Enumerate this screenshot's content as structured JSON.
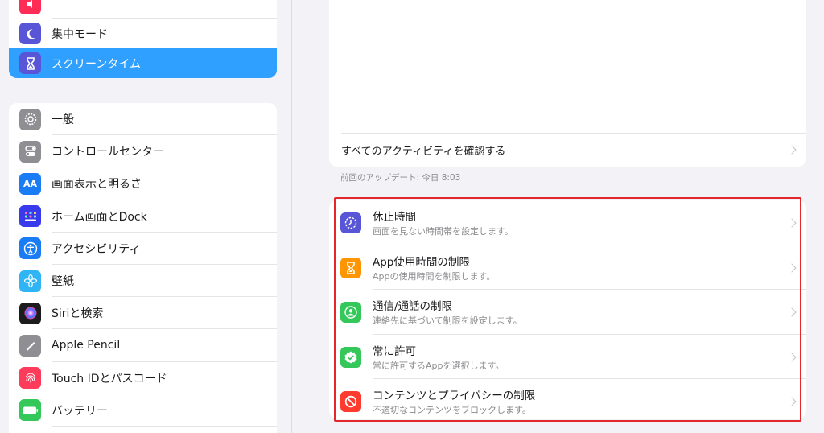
{
  "sidebar": {
    "group1": [
      {
        "label": "",
        "icon": "sound-icon",
        "color": "#ff2d55"
      },
      {
        "label": "集中モード",
        "icon": "moon-icon",
        "color": "#5856d6"
      },
      {
        "label": "スクリーンタイム",
        "icon": "hourglass-icon",
        "color": "#5856d6",
        "selected": true
      }
    ],
    "group2": [
      {
        "label": "一般",
        "icon": "gear-icon",
        "color": "#8e8e93"
      },
      {
        "label": "コントロールセンター",
        "icon": "toggles-icon",
        "color": "#8e8e93"
      },
      {
        "label": "画面表示と明るさ",
        "icon": "text-size-icon",
        "color": "#1a7cf5"
      },
      {
        "label": "ホーム画面とDock",
        "icon": "grid-icon",
        "color": "#3a3aed"
      },
      {
        "label": "アクセシビリティ",
        "icon": "accessibility-icon",
        "color": "#1a7cf5"
      },
      {
        "label": "壁紙",
        "icon": "flower-icon",
        "color": "#2fb4f5"
      },
      {
        "label": "Siriと検索",
        "icon": "siri-icon",
        "color": "#1c1c1e"
      },
      {
        "label": "Apple Pencil",
        "icon": "pencil-icon",
        "color": "#8e8e93"
      },
      {
        "label": "Touch IDとパスコード",
        "icon": "fingerprint-icon",
        "color": "#ff3b5c"
      },
      {
        "label": "バッテリー",
        "icon": "battery-icon",
        "color": "#34c759"
      }
    ],
    "selected_color": "#2fa0ff"
  },
  "main": {
    "activity_link": "すべてのアクティビティを確認する",
    "update_note": "前回のアップデート: 今日 8:03",
    "limits": [
      {
        "title": "休止時間",
        "subtitle": "画面を見ない時間帯を設定します。",
        "icon": "downtime-icon",
        "color": "#5856d6"
      },
      {
        "title": "App使用時間の制限",
        "subtitle": "Appの使用時間を制限します。",
        "icon": "hourglass-icon",
        "color": "#ff9500"
      },
      {
        "title": "通信/通話の制限",
        "subtitle": "連絡先に基づいて制限を設定します。",
        "icon": "contact-icon",
        "color": "#34c759"
      },
      {
        "title": "常に許可",
        "subtitle": "常に許可するAppを選択します。",
        "icon": "checkmark-badge-icon",
        "color": "#34c759"
      },
      {
        "title": "コンテンツとプライバシーの制限",
        "subtitle": "不適切なコンテンツをブロックします。",
        "icon": "prohibited-icon",
        "color": "#ff3b30"
      }
    ],
    "highlight_color": "#e4272c"
  }
}
